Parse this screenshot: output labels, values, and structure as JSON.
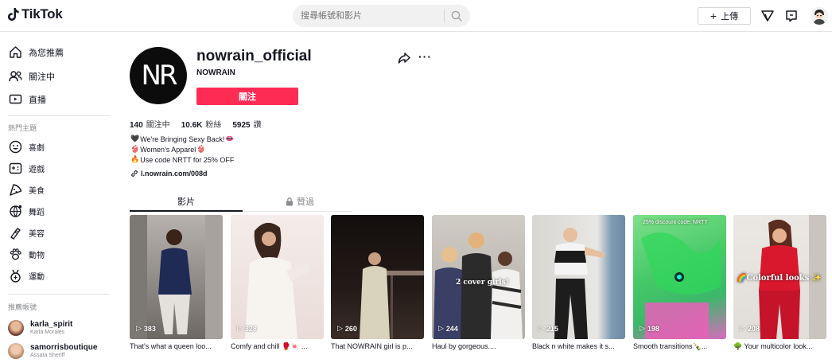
{
  "header": {
    "logo_text": "TikTok",
    "search_placeholder": "搜尋帳號和影片",
    "upload_label": "上傳"
  },
  "sidebar": {
    "nav": [
      {
        "label": "為您推薦",
        "icon": "home-icon"
      },
      {
        "label": "關注中",
        "icon": "following-icon"
      },
      {
        "label": "直播",
        "icon": "live-icon"
      }
    ],
    "topics_heading": "熱門主題",
    "topics": [
      {
        "label": "喜劇",
        "icon": "comedy-icon"
      },
      {
        "label": "遊戲",
        "icon": "gaming-icon"
      },
      {
        "label": "美食",
        "icon": "food-icon"
      },
      {
        "label": "舞蹈",
        "icon": "dance-icon"
      },
      {
        "label": "美容",
        "icon": "beauty-icon"
      },
      {
        "label": "動物",
        "icon": "animals-icon"
      },
      {
        "label": "運動",
        "icon": "sports-icon"
      }
    ],
    "accounts_heading": "推薦帳號",
    "accounts": [
      {
        "username": "karla_spirit",
        "name": "Karla Morales"
      },
      {
        "username": "samorrisboutique",
        "name": "Assata Sheriff"
      }
    ]
  },
  "profile": {
    "avatar_text": "NR",
    "username": "nowrain_official",
    "nickname": "NOWRAIN",
    "follow_label": "關注",
    "stats": [
      {
        "value": "140",
        "label": "關注中"
      },
      {
        "value": "10.6K",
        "label": "粉絲"
      },
      {
        "value": "5925",
        "label": "讚"
      }
    ],
    "bio": [
      {
        "emoji": "🖤",
        "text": "We're Bringing Sexy Back!",
        "emoji_after": "👄"
      },
      {
        "emoji": "👙",
        "text": "Women's Apparel",
        "emoji_after": "👙"
      },
      {
        "emoji": "🔥",
        "text": "Use code NRTT for 25% OFF",
        "emoji_after": ""
      }
    ],
    "link": "l.nowrain.com/008d"
  },
  "tabs": {
    "videos": "影片",
    "liked": "贊過"
  },
  "videos": [
    {
      "views": "383",
      "caption": "That's what a queen loo...",
      "overlay": ""
    },
    {
      "views": "328",
      "caption": "Comfy and chill 🥊🍬 ...",
      "overlay": ""
    },
    {
      "views": "260",
      "caption": "That NOWRAIN girl is p...",
      "overlay": ""
    },
    {
      "views": "244",
      "caption": "Haul by gorgeous....",
      "overlay": "2 cover girls!"
    },
    {
      "views": "215",
      "caption": "Black n white makes it s...",
      "overlay": ""
    },
    {
      "views": "198",
      "caption": "Smooth transitions🍾...",
      "overlay": "25% discount code: NRTT"
    },
    {
      "views": "208",
      "caption": "🌳 Your multicolor look...",
      "overlay": "🌈Colorful looks ✨"
    }
  ],
  "colors": {
    "accent": "#fe2c55",
    "text": "#161823",
    "muted": "#8a8b91"
  }
}
